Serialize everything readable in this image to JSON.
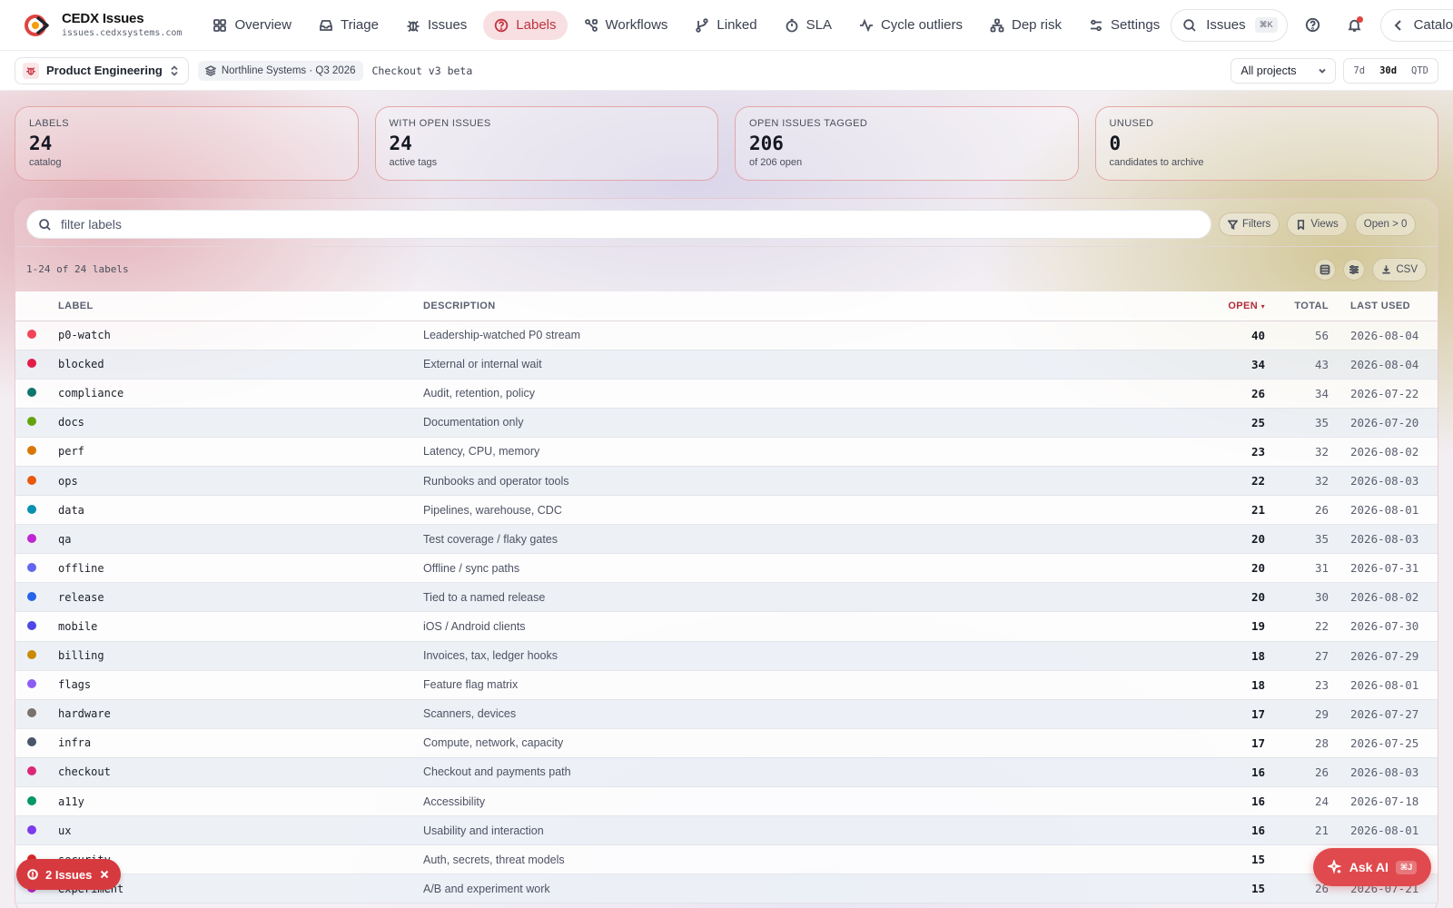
{
  "brand": {
    "name": "CEDX Issues",
    "domain": "issues.cedxsystems.com",
    "accent": "#e0443f"
  },
  "nav": {
    "items": [
      {
        "label": "Overview",
        "icon": "grid-icon",
        "active": false
      },
      {
        "label": "Triage",
        "icon": "inbox-icon",
        "active": false
      },
      {
        "label": "Issues",
        "icon": "bug-icon",
        "active": false
      },
      {
        "label": "Labels",
        "icon": "help-circle-icon",
        "active": true
      },
      {
        "label": "Workflows",
        "icon": "workflow-icon",
        "active": false
      },
      {
        "label": "Linked",
        "icon": "branch-icon",
        "active": false
      },
      {
        "label": "SLA",
        "icon": "timer-icon",
        "active": false
      },
      {
        "label": "Cycle outliers",
        "icon": "activity-icon",
        "active": false
      },
      {
        "label": "Dep risk",
        "icon": "network-icon",
        "active": false
      },
      {
        "label": "Settings",
        "icon": "sliders-icon",
        "active": false
      }
    ],
    "search_label": "Issues",
    "search_shortcut": "⌘K",
    "catalog_label": "Catalog"
  },
  "subbar": {
    "workspace": "Product Engineering",
    "org_chip": "Northline Systems · Q3 2026",
    "release": "Checkout v3 beta",
    "project_select": "All projects",
    "ranges": [
      "7d",
      "30d",
      "QTD"
    ],
    "active_range": "30d"
  },
  "stats": [
    {
      "label": "LABELS",
      "value": "24",
      "sub": "catalog"
    },
    {
      "label": "WITH OPEN ISSUES",
      "value": "24",
      "sub": "active tags"
    },
    {
      "label": "OPEN ISSUES TAGGED",
      "value": "206",
      "sub": "of 206 open"
    },
    {
      "label": "UNUSED",
      "value": "0",
      "sub": "candidates to archive"
    }
  ],
  "filter": {
    "placeholder": "filter labels",
    "filters_label": "Filters",
    "views_label": "Views",
    "open_filter_label": "Open > 0"
  },
  "table_meta": {
    "count_text": "1-24 of 24 labels",
    "csv_label": "CSV"
  },
  "columns": {
    "label": "LABEL",
    "description": "DESCRIPTION",
    "open": "OPEN",
    "total": "TOTAL",
    "last_used": "LAST USED"
  },
  "rows": [
    {
      "color": "#f0455a",
      "label": "p0-watch",
      "description": "Leadership-watched P0 stream",
      "open": "40",
      "total": "56",
      "last_used": "2026-08-04"
    },
    {
      "color": "#e11d48",
      "label": "blocked",
      "description": "External or internal wait",
      "open": "34",
      "total": "43",
      "last_used": "2026-08-04"
    },
    {
      "color": "#0f766e",
      "label": "compliance",
      "description": "Audit, retention, policy",
      "open": "26",
      "total": "34",
      "last_used": "2026-07-22"
    },
    {
      "color": "#65a30d",
      "label": "docs",
      "description": "Documentation only",
      "open": "25",
      "total": "35",
      "last_used": "2026-07-20"
    },
    {
      "color": "#d97706",
      "label": "perf",
      "description": "Latency, CPU, memory",
      "open": "23",
      "total": "32",
      "last_used": "2026-08-02"
    },
    {
      "color": "#ea580c",
      "label": "ops",
      "description": "Runbooks and operator tools",
      "open": "22",
      "total": "32",
      "last_used": "2026-08-03"
    },
    {
      "color": "#0891b2",
      "label": "data",
      "description": "Pipelines, warehouse, CDC",
      "open": "21",
      "total": "26",
      "last_used": "2026-08-01"
    },
    {
      "color": "#c026d3",
      "label": "qa",
      "description": "Test coverage / flaky gates",
      "open": "20",
      "total": "35",
      "last_used": "2026-08-03"
    },
    {
      "color": "#6366f1",
      "label": "offline",
      "description": "Offline / sync paths",
      "open": "20",
      "total": "31",
      "last_used": "2026-07-31"
    },
    {
      "color": "#2563eb",
      "label": "release",
      "description": "Tied to a named release",
      "open": "20",
      "total": "30",
      "last_used": "2026-08-02"
    },
    {
      "color": "#4f46e5",
      "label": "mobile",
      "description": "iOS / Android clients",
      "open": "19",
      "total": "22",
      "last_used": "2026-07-30"
    },
    {
      "color": "#ca8a04",
      "label": "billing",
      "description": "Invoices, tax, ledger hooks",
      "open": "18",
      "total": "27",
      "last_used": "2026-07-29"
    },
    {
      "color": "#8b5cf6",
      "label": "flags",
      "description": "Feature flag matrix",
      "open": "18",
      "total": "23",
      "last_used": "2026-08-01"
    },
    {
      "color": "#78716c",
      "label": "hardware",
      "description": "Scanners, devices",
      "open": "17",
      "total": "29",
      "last_used": "2026-07-27"
    },
    {
      "color": "#475569",
      "label": "infra",
      "description": "Compute, network, capacity",
      "open": "17",
      "total": "28",
      "last_used": "2026-07-25"
    },
    {
      "color": "#db2777",
      "label": "checkout",
      "description": "Checkout and payments path",
      "open": "16",
      "total": "26",
      "last_used": "2026-08-03"
    },
    {
      "color": "#059669",
      "label": "a11y",
      "description": "Accessibility",
      "open": "16",
      "total": "24",
      "last_used": "2026-07-18"
    },
    {
      "color": "#7c3aed",
      "label": "ux",
      "description": "Usability and interaction",
      "open": "16",
      "total": "21",
      "last_used": "2026-08-01"
    },
    {
      "color": "#dc2626",
      "label": "security",
      "description": "Auth, secrets, threat models",
      "open": "15",
      "total": "",
      "last_used": ""
    },
    {
      "color": "#c026d3",
      "label": "experiment",
      "description": "A/B and experiment work",
      "open": "15",
      "total": "26",
      "last_used": "2026-07-21"
    }
  ],
  "floating": {
    "issues_badge": "2 Issues",
    "ask_ai": "Ask AI",
    "ask_ai_shortcut": "⌘J"
  }
}
